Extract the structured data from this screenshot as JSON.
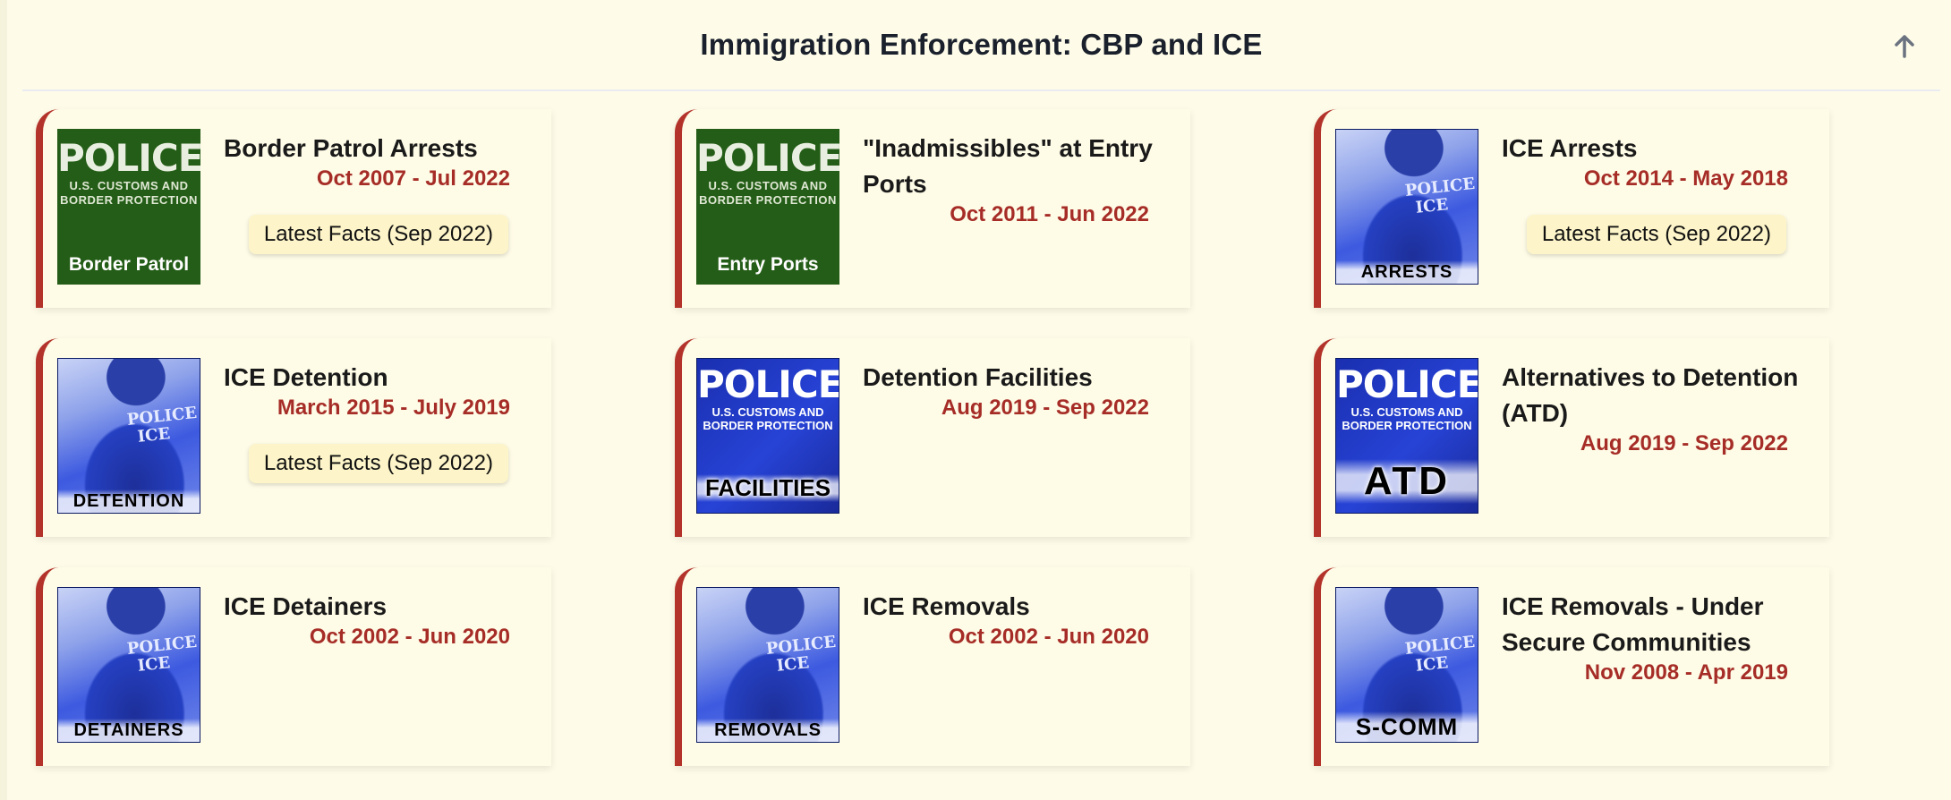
{
  "header": {
    "title": "Immigration Enforcement: CBP and ICE",
    "scroll_top_icon": "arrow-up-icon"
  },
  "cards": [
    {
      "title": "Border Patrol Arrests",
      "dates": "Oct 2007 - Jul 2022",
      "button": "Latest Facts (Sep 2022)",
      "thumb": {
        "style": "green",
        "headline": "POLICE",
        "sub1": "U.S. CUSTOMS AND",
        "sub2": "BORDER PROTECTION",
        "label": "Border Patrol"
      }
    },
    {
      "title": "\"Inadmissibles\" at Entry Ports",
      "dates": "Oct 2011 - Jun 2022",
      "thumb": {
        "style": "green",
        "headline": "POLICE",
        "sub1": "U.S. CUSTOMS AND",
        "sub2": "BORDER PROTECTION",
        "label": "Entry Ports"
      }
    },
    {
      "title": "ICE Arrests",
      "dates": "Oct 2014 - May 2018",
      "button": "Latest Facts (Sep 2022)",
      "thumb": {
        "style": "photo",
        "jacket1": "POLICE",
        "jacket2": "ICE",
        "label": "ARRESTS"
      }
    },
    {
      "title": "ICE Detention",
      "dates": "March 2015 - July 2019",
      "button": "Latest Facts (Sep 2022)",
      "thumb": {
        "style": "photo",
        "jacket1": "POLICE",
        "jacket2": "ICE",
        "label": "DETENTION"
      }
    },
    {
      "title": "Detention Facilities",
      "dates": "Aug 2019 - Sep 2022",
      "thumb": {
        "style": "blue",
        "headline": "POLICE",
        "sub1": "U.S. CUSTOMS AND",
        "sub2": "BORDER PROTECTION",
        "label": "FACILITIES"
      }
    },
    {
      "title": "Alternatives to Detention (ATD)",
      "dates": "Aug 2019 - Sep 2022",
      "thumb": {
        "style": "blue",
        "headline": "POLICE",
        "sub1": "U.S. CUSTOMS AND",
        "sub2": "BORDER PROTECTION",
        "label": "ATD"
      }
    },
    {
      "title": "ICE Detainers",
      "dates": "Oct 2002 - Jun 2020",
      "thumb": {
        "style": "photo",
        "jacket1": "POLICE",
        "jacket2": "ICE",
        "label": "DETAINERS"
      }
    },
    {
      "title": "ICE Removals",
      "dates": "Oct 2002 - Jun 2020",
      "thumb": {
        "style": "photo",
        "jacket1": "POLICE",
        "jacket2": "ICE",
        "label": "REMOVALS"
      }
    },
    {
      "title": "ICE Removals - Under Secure Communities",
      "dates": "Nov 2008 - Apr 2019",
      "thumb": {
        "style": "photo",
        "jacket1": "POLICE",
        "jacket2": "ICE",
        "label": "S-COMM"
      }
    }
  ],
  "colors": {
    "background": "#fefce8",
    "card_accent": "#b3332b",
    "date_text": "#a62d27",
    "button_bg": "#fdf5c9"
  }
}
